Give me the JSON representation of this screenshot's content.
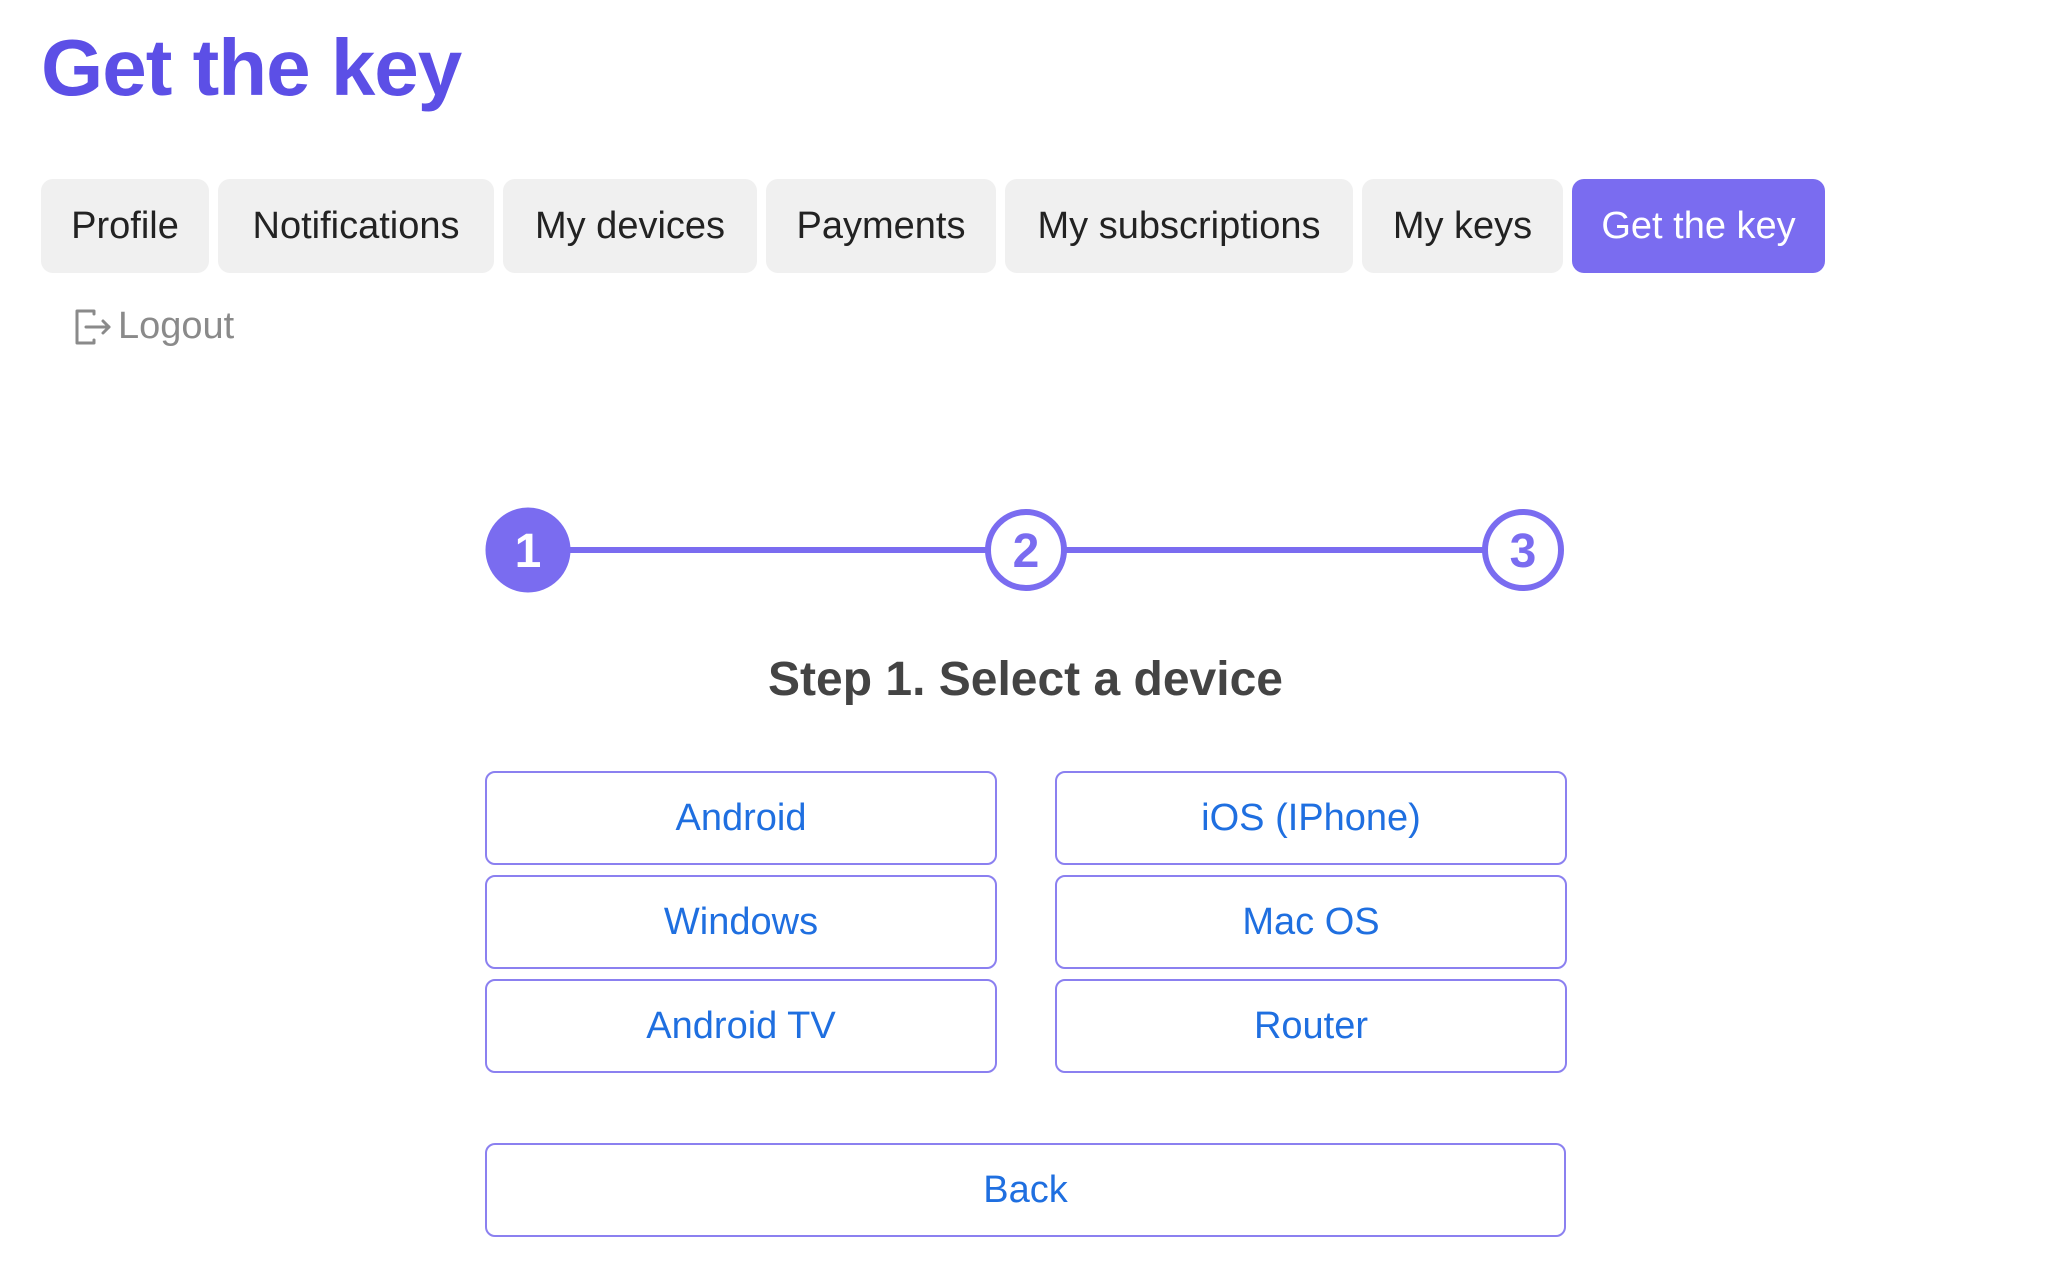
{
  "header": {
    "title": "Get the key"
  },
  "tabs": [
    {
      "label": "Profile",
      "active": false
    },
    {
      "label": "Notifications",
      "active": false
    },
    {
      "label": "My devices",
      "active": false
    },
    {
      "label": "Payments",
      "active": false
    },
    {
      "label": "My subscriptions",
      "active": false
    },
    {
      "label": "My keys",
      "active": false
    },
    {
      "label": "Get the key",
      "active": true
    }
  ],
  "logout": {
    "label": "Logout",
    "icon": "logout-icon"
  },
  "stepper": {
    "steps": [
      "1",
      "2",
      "3"
    ],
    "current": 1
  },
  "step_title": "Step 1. Select a device",
  "devices": [
    "Android",
    "iOS (IPhone)",
    "Windows",
    "Mac OS",
    "Android TV",
    "Router"
  ],
  "back_label": "Back",
  "colors": {
    "accent": "#7a6cf0",
    "title": "#5c4fe6",
    "link": "#1f6fe0",
    "tab_bg": "#f0f0f0",
    "button_border": "#8b80f0"
  }
}
